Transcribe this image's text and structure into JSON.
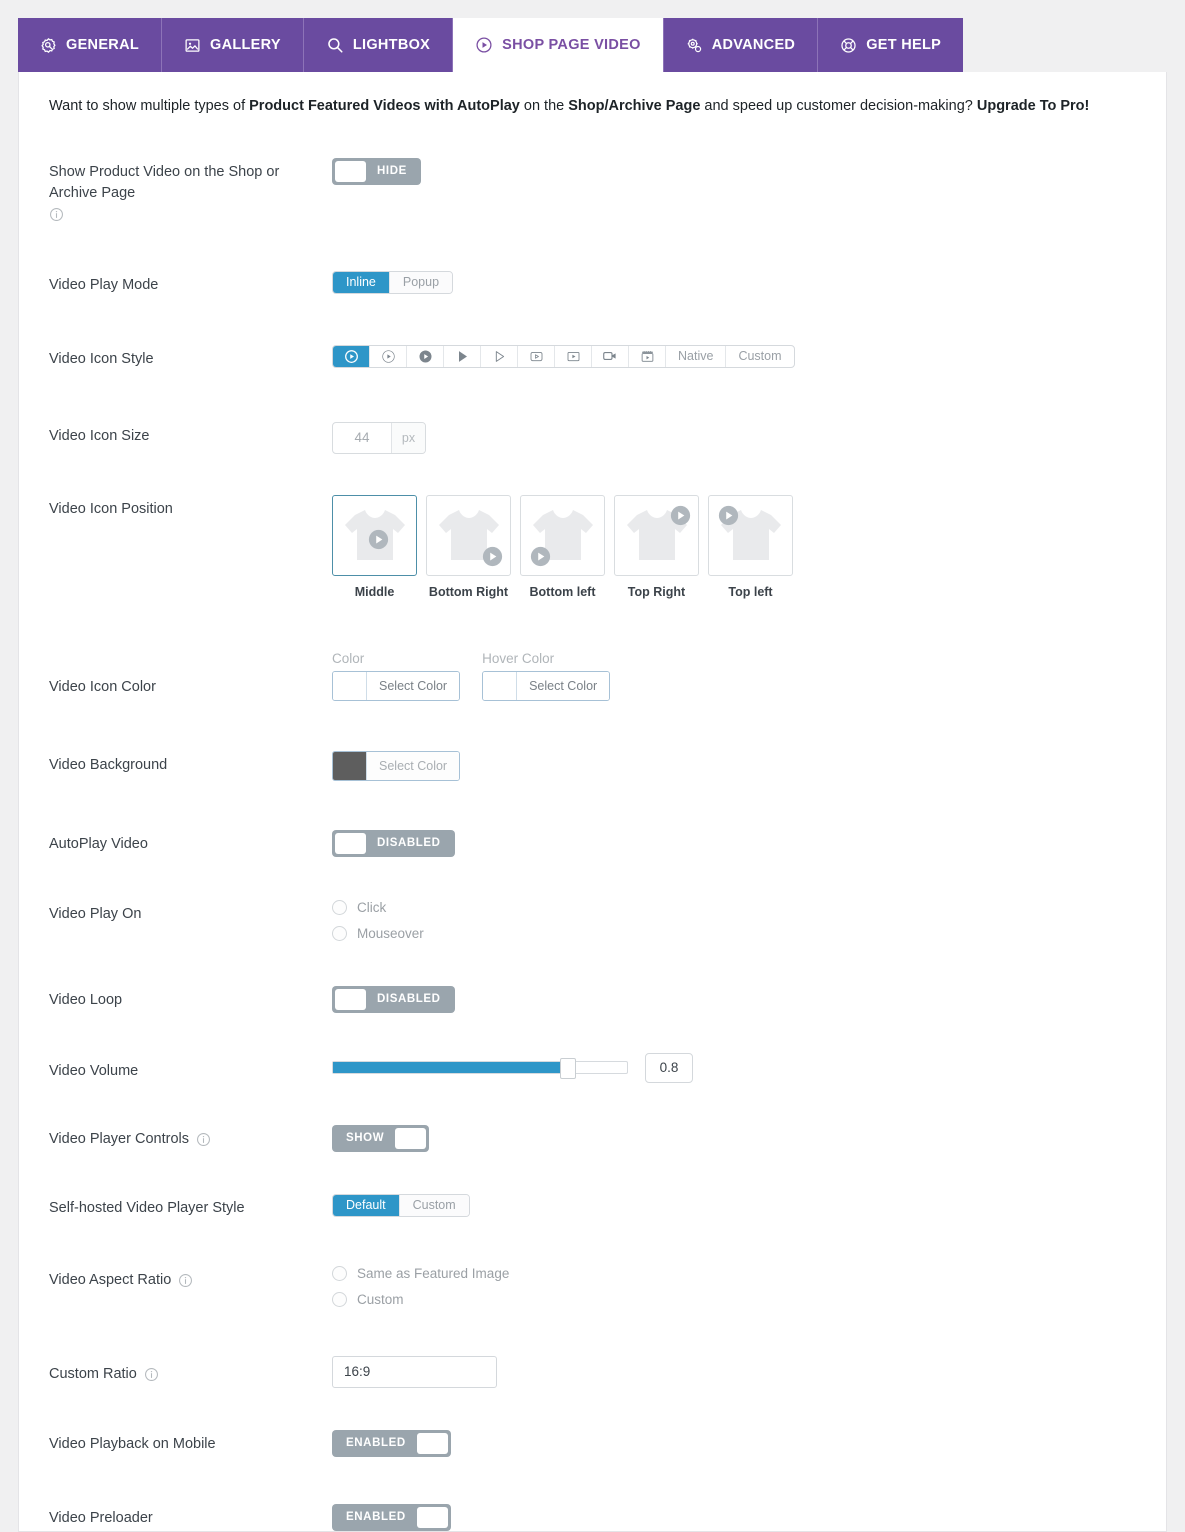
{
  "tabs": [
    {
      "label": "GENERAL",
      "icon": "badge-gear-icon",
      "active": false
    },
    {
      "label": "GALLERY",
      "icon": "image-gallery-icon",
      "active": false
    },
    {
      "label": "LIGHTBOX",
      "icon": "search-icon",
      "active": false
    },
    {
      "label": "SHOP PAGE VIDEO",
      "icon": "play-circle-icon",
      "active": true
    },
    {
      "label": "ADVANCED",
      "icon": "gears-icon",
      "active": false
    },
    {
      "label": "GET HELP",
      "icon": "lifebuoy-icon",
      "active": false
    }
  ],
  "notice": {
    "p1": "Want to show multiple types of ",
    "b1": "Product Featured Videos with AutoPlay",
    "p2": " on the ",
    "b2": "Shop/Archive Page",
    "p3": " and speed up customer decision-making? ",
    "b3": "Upgrade To Pro!"
  },
  "rows": {
    "show_product_video": {
      "label": "Show Product Video on the Shop or Archive Page",
      "has_info": true,
      "toggle_text": "HIDE",
      "toggle_state": "off"
    },
    "video_play_mode": {
      "label": "Video Play Mode",
      "options": [
        "Inline",
        "Popup"
      ],
      "selected": "Inline"
    },
    "video_icon_style": {
      "label": "Video Icon Style",
      "icon_options": [
        "play-circle-outline-thick-icon",
        "play-circle-outline-thin-icon",
        "play-circle-filled-icon",
        "play-triangle-filled-icon",
        "play-triangle-outline-icon",
        "play-rounded-rect-outline-icon",
        "play-square-filled-icon",
        "video-camera-icon",
        "film-clapper-icon"
      ],
      "text_options": [
        "Native",
        "Custom"
      ],
      "selected_index": 0
    },
    "video_icon_size": {
      "label": "Video Icon Size",
      "value": "44",
      "unit": "px"
    },
    "video_icon_position": {
      "label": "Video Icon Position",
      "items": [
        {
          "caption": "Middle",
          "pos": "middle",
          "selected": true
        },
        {
          "caption": "Bottom Right",
          "pos": "bottom-right",
          "selected": false
        },
        {
          "caption": "Bottom left",
          "pos": "bottom-left",
          "selected": false
        },
        {
          "caption": "Top Right",
          "pos": "top-right",
          "selected": false
        },
        {
          "caption": "Top left",
          "pos": "top-left",
          "selected": false
        }
      ]
    },
    "video_icon_color": {
      "label": "Video Icon Color",
      "color_label": "Color",
      "color_button": "Select Color",
      "hover_label": "Hover Color",
      "hover_button": "Select Color"
    },
    "video_background": {
      "label": "Video Background",
      "button": "Select Color",
      "swatch": "#5e5e5e"
    },
    "autoplay_video": {
      "label": "AutoPlay Video",
      "toggle_text": "DISABLED",
      "toggle_state": "off"
    },
    "video_play_on": {
      "label": "Video Play On",
      "options": [
        "Click",
        "Mouseover"
      ]
    },
    "video_loop": {
      "label": "Video Loop",
      "toggle_text": "DISABLED",
      "toggle_state": "off"
    },
    "video_volume": {
      "label": "Video Volume",
      "value": "0.8",
      "percent": 80
    },
    "video_player_controls": {
      "label": "Video Player Controls",
      "has_info": true,
      "toggle_text": "SHOW",
      "toggle_state": "on"
    },
    "player_style": {
      "label": "Self-hosted Video Player Style",
      "options": [
        "Default",
        "Custom"
      ],
      "selected": "Default"
    },
    "video_aspect_ratio": {
      "label": "Video Aspect Ratio",
      "has_info": true,
      "options": [
        "Same as Featured Image",
        "Custom"
      ]
    },
    "custom_ratio": {
      "label": "Custom Ratio",
      "has_info": true,
      "value": "16:9"
    },
    "video_playback_mobile": {
      "label": "Video Playback on Mobile",
      "toggle_text": "ENABLED",
      "toggle_state": "on"
    },
    "video_preloader": {
      "label": "Video Preloader",
      "toggle_text": "ENABLED",
      "toggle_state": "on"
    }
  },
  "colors": {
    "tab_purple": "#6a4ba0",
    "tab_active_text": "#7a4fa3",
    "accent_blue": "#2e96c8",
    "toggle_gray": "#9aa5ad"
  }
}
